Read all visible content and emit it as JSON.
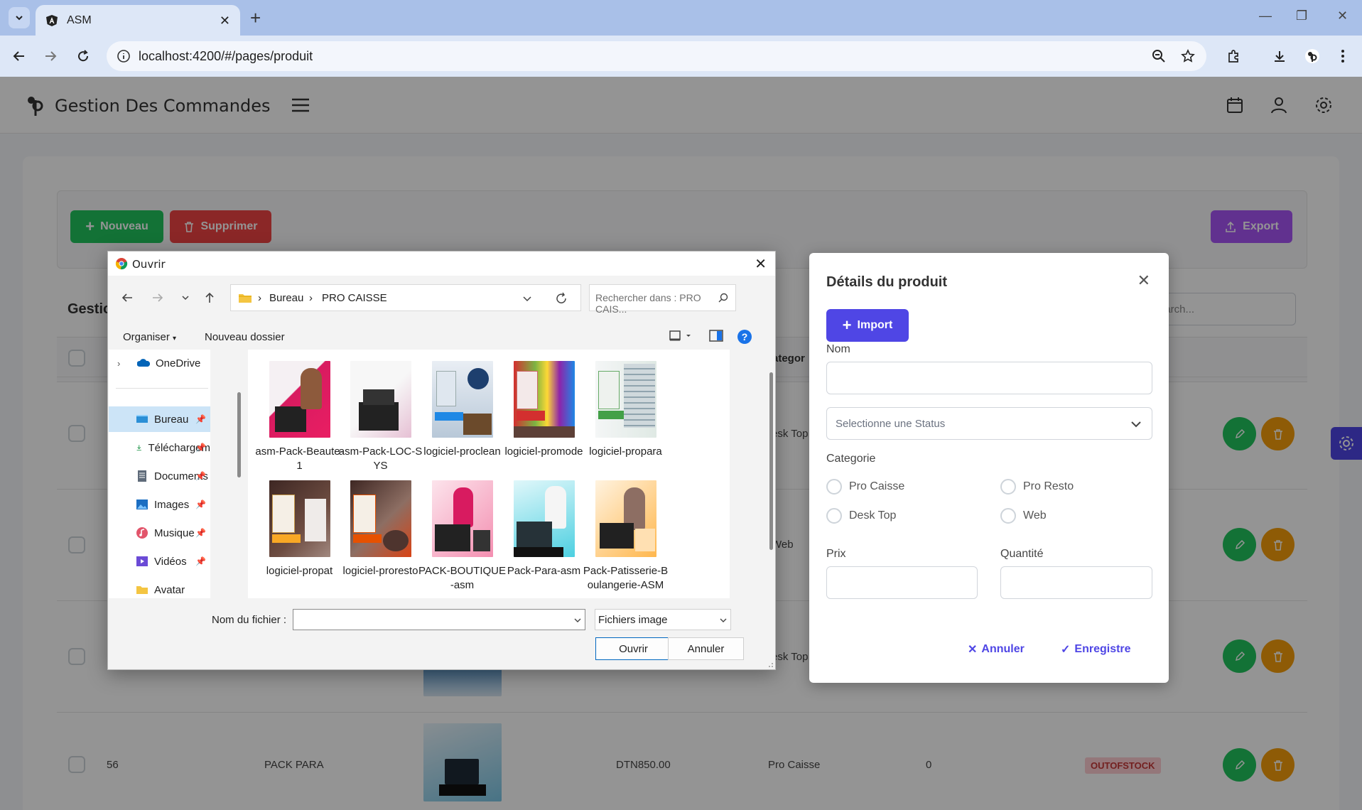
{
  "browser": {
    "tab_title": "ASM",
    "url": "localhost:4200/#/pages/produit"
  },
  "app": {
    "title": "Gestion Des Commandes",
    "toolbar": {
      "new_label": "Nouveau",
      "delete_label": "Supprimer",
      "export_label": "Export"
    },
    "table": {
      "title_fragment": "Gestio",
      "search_placeholder": "earch...",
      "category_header_fragment": "ategor",
      "partial_categories": [
        "esk Top",
        "Web",
        "esk Top"
      ],
      "last_row": {
        "id": "56",
        "name": "PACK PARA",
        "price": "DTN850.00",
        "category": "Pro Caisse",
        "quantity": "0",
        "status": "OUTOFSTOCK"
      }
    }
  },
  "file_dialog": {
    "title": "Ouvrir",
    "breadcrumb": [
      "Bureau",
      "PRO CAISSE"
    ],
    "search_placeholder": "Rechercher dans : PRO CAIS...",
    "organize_label": "Organiser",
    "new_folder_label": "Nouveau dossier",
    "nav_items": [
      {
        "label": "OneDrive"
      },
      {
        "label": "Bureau"
      },
      {
        "label": "Téléchargem"
      },
      {
        "label": "Documents"
      },
      {
        "label": "Images"
      },
      {
        "label": "Musique"
      },
      {
        "label": "Vidéos"
      },
      {
        "label": "Avatar"
      }
    ],
    "files": [
      {
        "name": "asm-Pack-Beaute-1"
      },
      {
        "name": "asm-Pack-LOC-SYS"
      },
      {
        "name": "logiciel-proclean"
      },
      {
        "name": "logiciel-promode"
      },
      {
        "name": "logiciel-propara"
      },
      {
        "name": "logiciel-propat"
      },
      {
        "name": "logiciel-proresto"
      },
      {
        "name": "PACK-BOUTIQUE-asm"
      },
      {
        "name": "Pack-Para-asm"
      },
      {
        "name": "Pack-Patisserie-Boulangerie-ASM"
      }
    ],
    "filename_label": "Nom du fichier :",
    "filetype_label": "Fichiers image",
    "open_label": "Ouvrir",
    "cancel_label": "Annuler"
  },
  "product_dialog": {
    "title": "Détails du produit",
    "import_label": "Import",
    "name_label": "Nom",
    "status_placeholder": "Selectionne une Status",
    "category_label": "Categorie",
    "categories": [
      "Pro Caisse",
      "Pro Resto",
      "Desk Top",
      "Web"
    ],
    "price_label": "Prix",
    "quantity_label": "Quantité",
    "cancel_label": "Annuler",
    "save_label": "Enregistre"
  },
  "colors": {
    "primary": "#4f46e5",
    "success": "#22c55e",
    "danger": "#ef4444",
    "export": "#a855f7",
    "warning": "#f59e0b"
  }
}
